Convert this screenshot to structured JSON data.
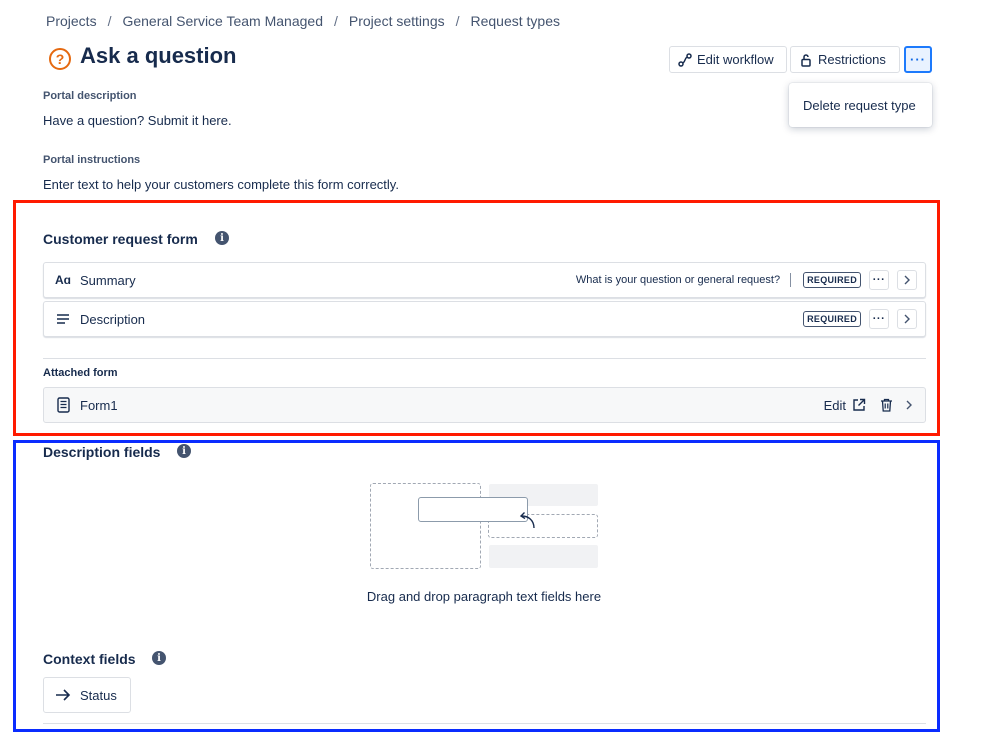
{
  "breadcrumb": [
    "Projects",
    "General Service Team Managed",
    "Project settings",
    "Request types"
  ],
  "breadcrumb_separator": "/",
  "page": {
    "title": "Ask a question",
    "icon": "question-icon",
    "icon_char": "?",
    "icon_color": "#e56910"
  },
  "header_actions": {
    "edit_workflow": "Edit workflow",
    "restrictions": "Restrictions",
    "more": "···"
  },
  "dropdown": {
    "delete_request_type": "Delete request type"
  },
  "portal": {
    "description_label": "Portal description",
    "description_value": "Have a question? Submit it here.",
    "instructions_label": "Portal instructions",
    "instructions_value": "Enter text to help your customers complete this form correctly."
  },
  "customer_request_form": {
    "title": "Customer request form",
    "fields": [
      {
        "icon": "text-icon",
        "icon_text": "Aɑ",
        "name": "Summary",
        "description": "What is your question or general request?",
        "badge": "REQUIRED"
      },
      {
        "icon": "paragraph-icon",
        "icon_text": "",
        "name": "Description",
        "description": "",
        "badge": "REQUIRED"
      }
    ],
    "attached_form_label": "Attached form",
    "attached_form": {
      "name": "Form1",
      "edit_label": "Edit"
    }
  },
  "description_fields": {
    "title": "Description fields",
    "empty_text": "Drag and drop paragraph text fields here"
  },
  "context_fields": {
    "title": "Context fields",
    "items": [
      {
        "name": "Status"
      }
    ]
  },
  "info_char": "i",
  "colors": {
    "highlight_red": "#ff1a00",
    "highlight_blue": "#0a2cff",
    "selected_blue": "#1d7afc"
  }
}
